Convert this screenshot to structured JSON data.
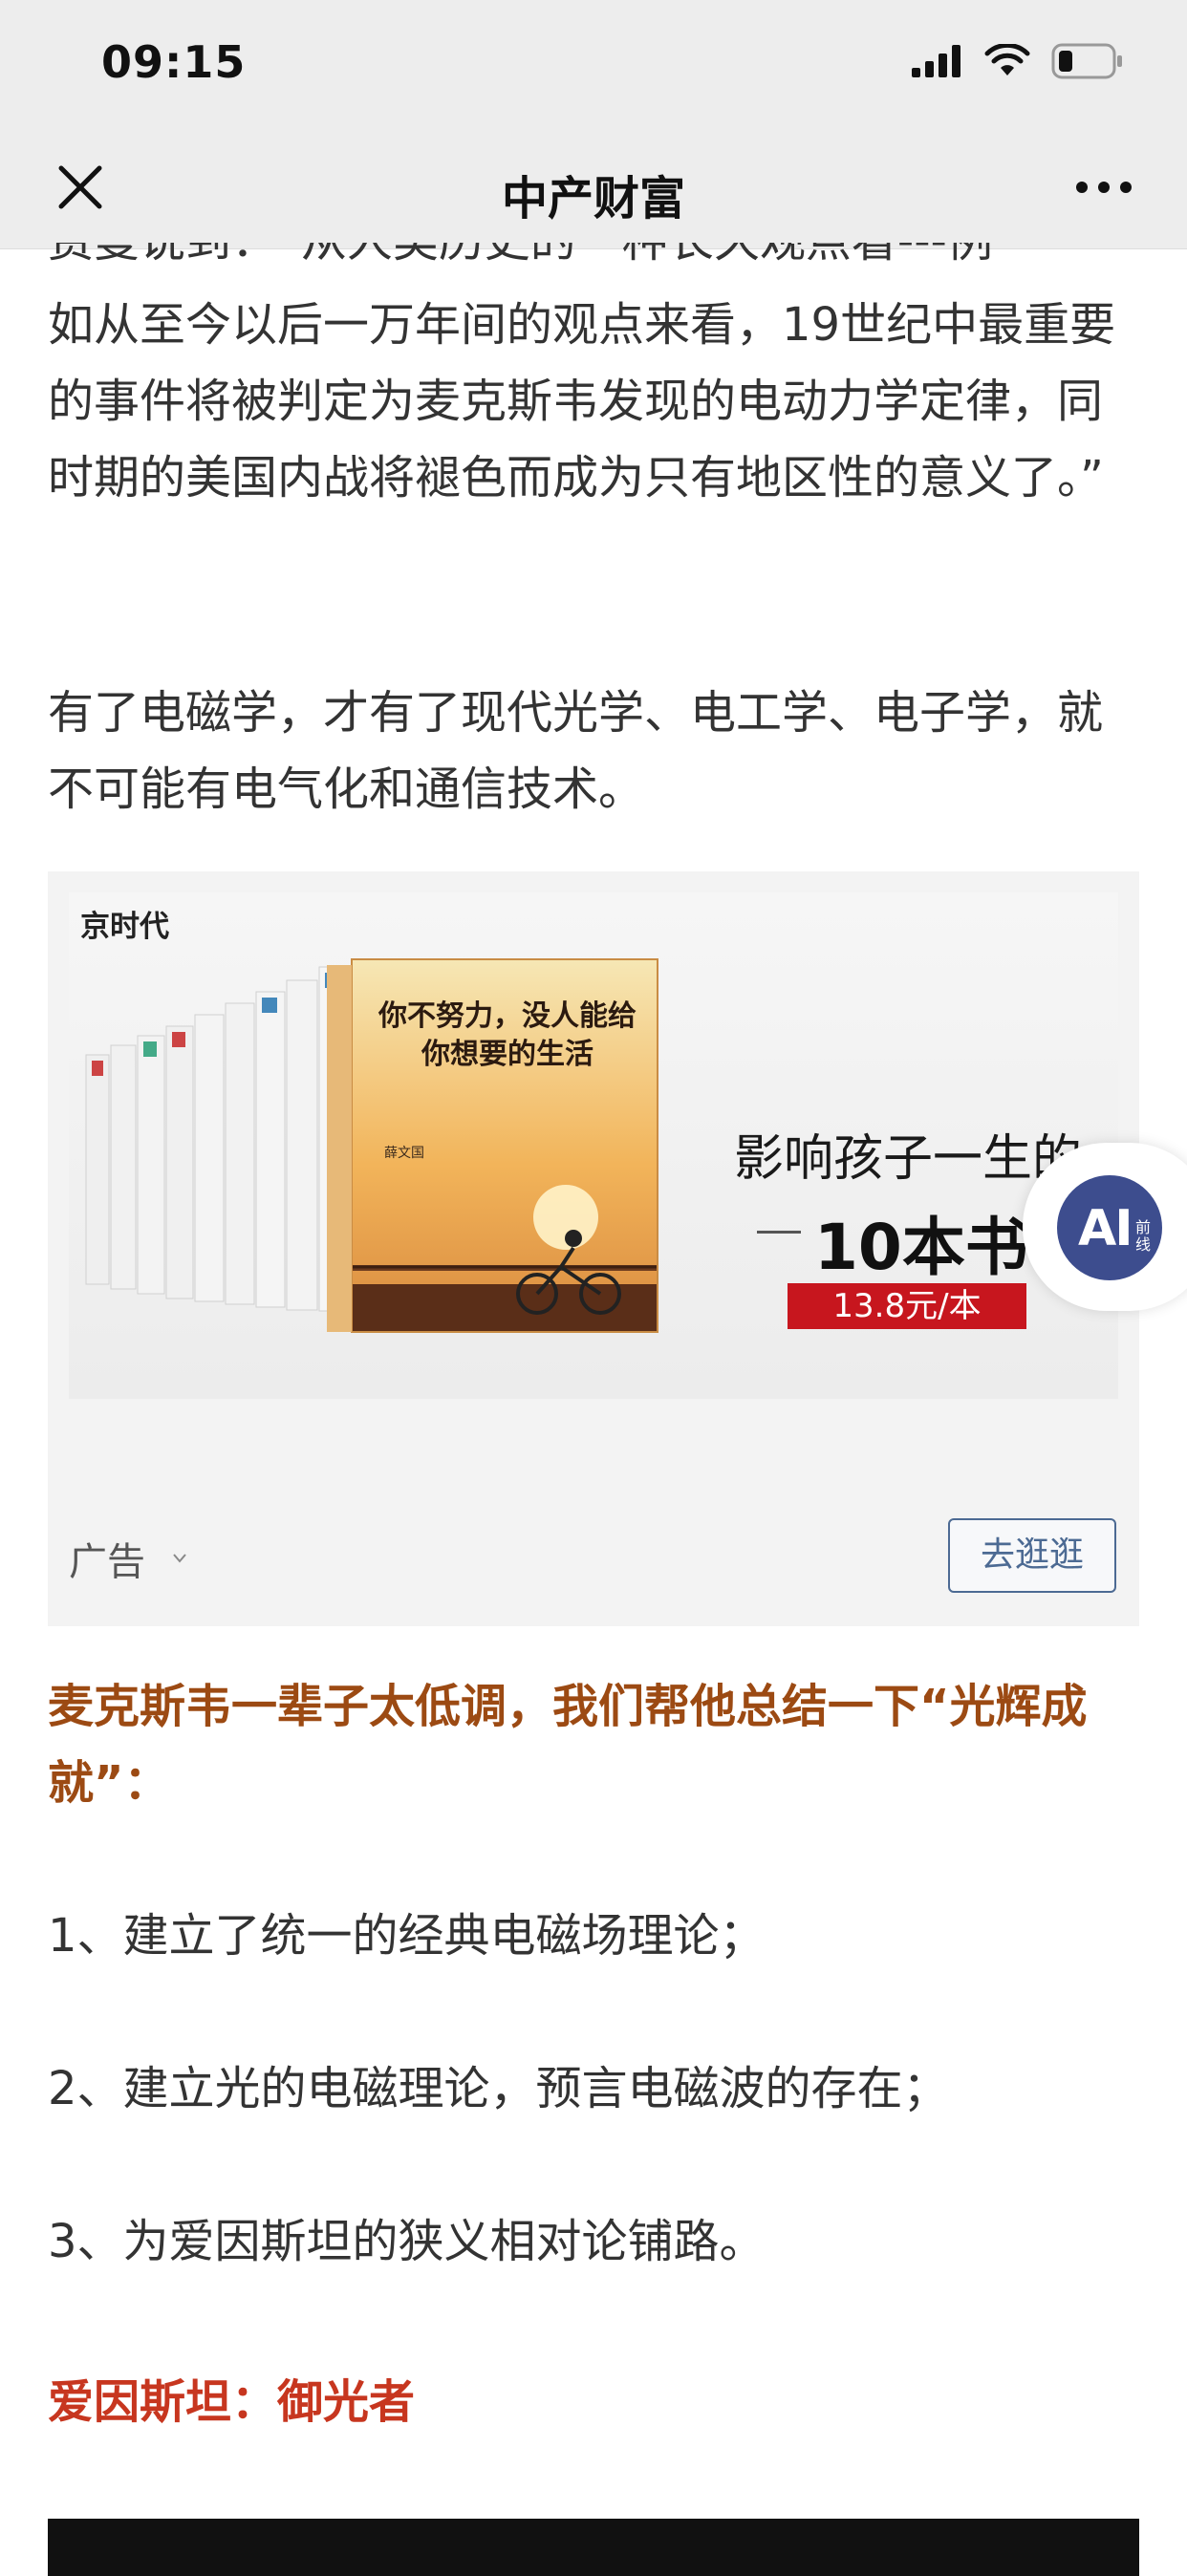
{
  "status_bar": {
    "time": "09:15"
  },
  "nav": {
    "title": "中产财富"
  },
  "article": {
    "cut_line": "费曼说到：“从人类历史的一种长久观点看---例",
    "p1": "如从至今以后一万年间的观点来看，19世纪中最重要的事件将被判定为麦克斯韦发现的电动力学定律，同时期的美国内战将褪色而成为只有地区性的意义了。”",
    "p2": "有了电磁学，才有了现代光学、电工学、电子学，就不可能有电气化和通信技术。",
    "p3": "麦克斯韦一辈子太低调，我们帮他总结一下“光辉成就”：",
    "list": [
      "1、建立了统一的经典电磁场理论；",
      "2、建立光的电磁理论，预言电磁波的存在；",
      "3、为爱因斯坦的狭义相对论铺路。"
    ],
    "section_title": "爱因斯坦：御光者"
  },
  "ad": {
    "brand": "京时代",
    "headline": "影响孩子一生的",
    "subhead": "10本书",
    "price": "13.8元/本",
    "cover_title": "你不努力，没人能给你想要的生活",
    "cover_author": "薛文国",
    "label": "广告",
    "button": "去逛逛"
  },
  "ai_badge": {
    "text": "AI",
    "sub": "前线"
  },
  "colors": {
    "brown": "#9c4a13",
    "red": "#c7361f",
    "link_blue": "#4c6a93",
    "badge_blue": "#3d4d8e"
  }
}
